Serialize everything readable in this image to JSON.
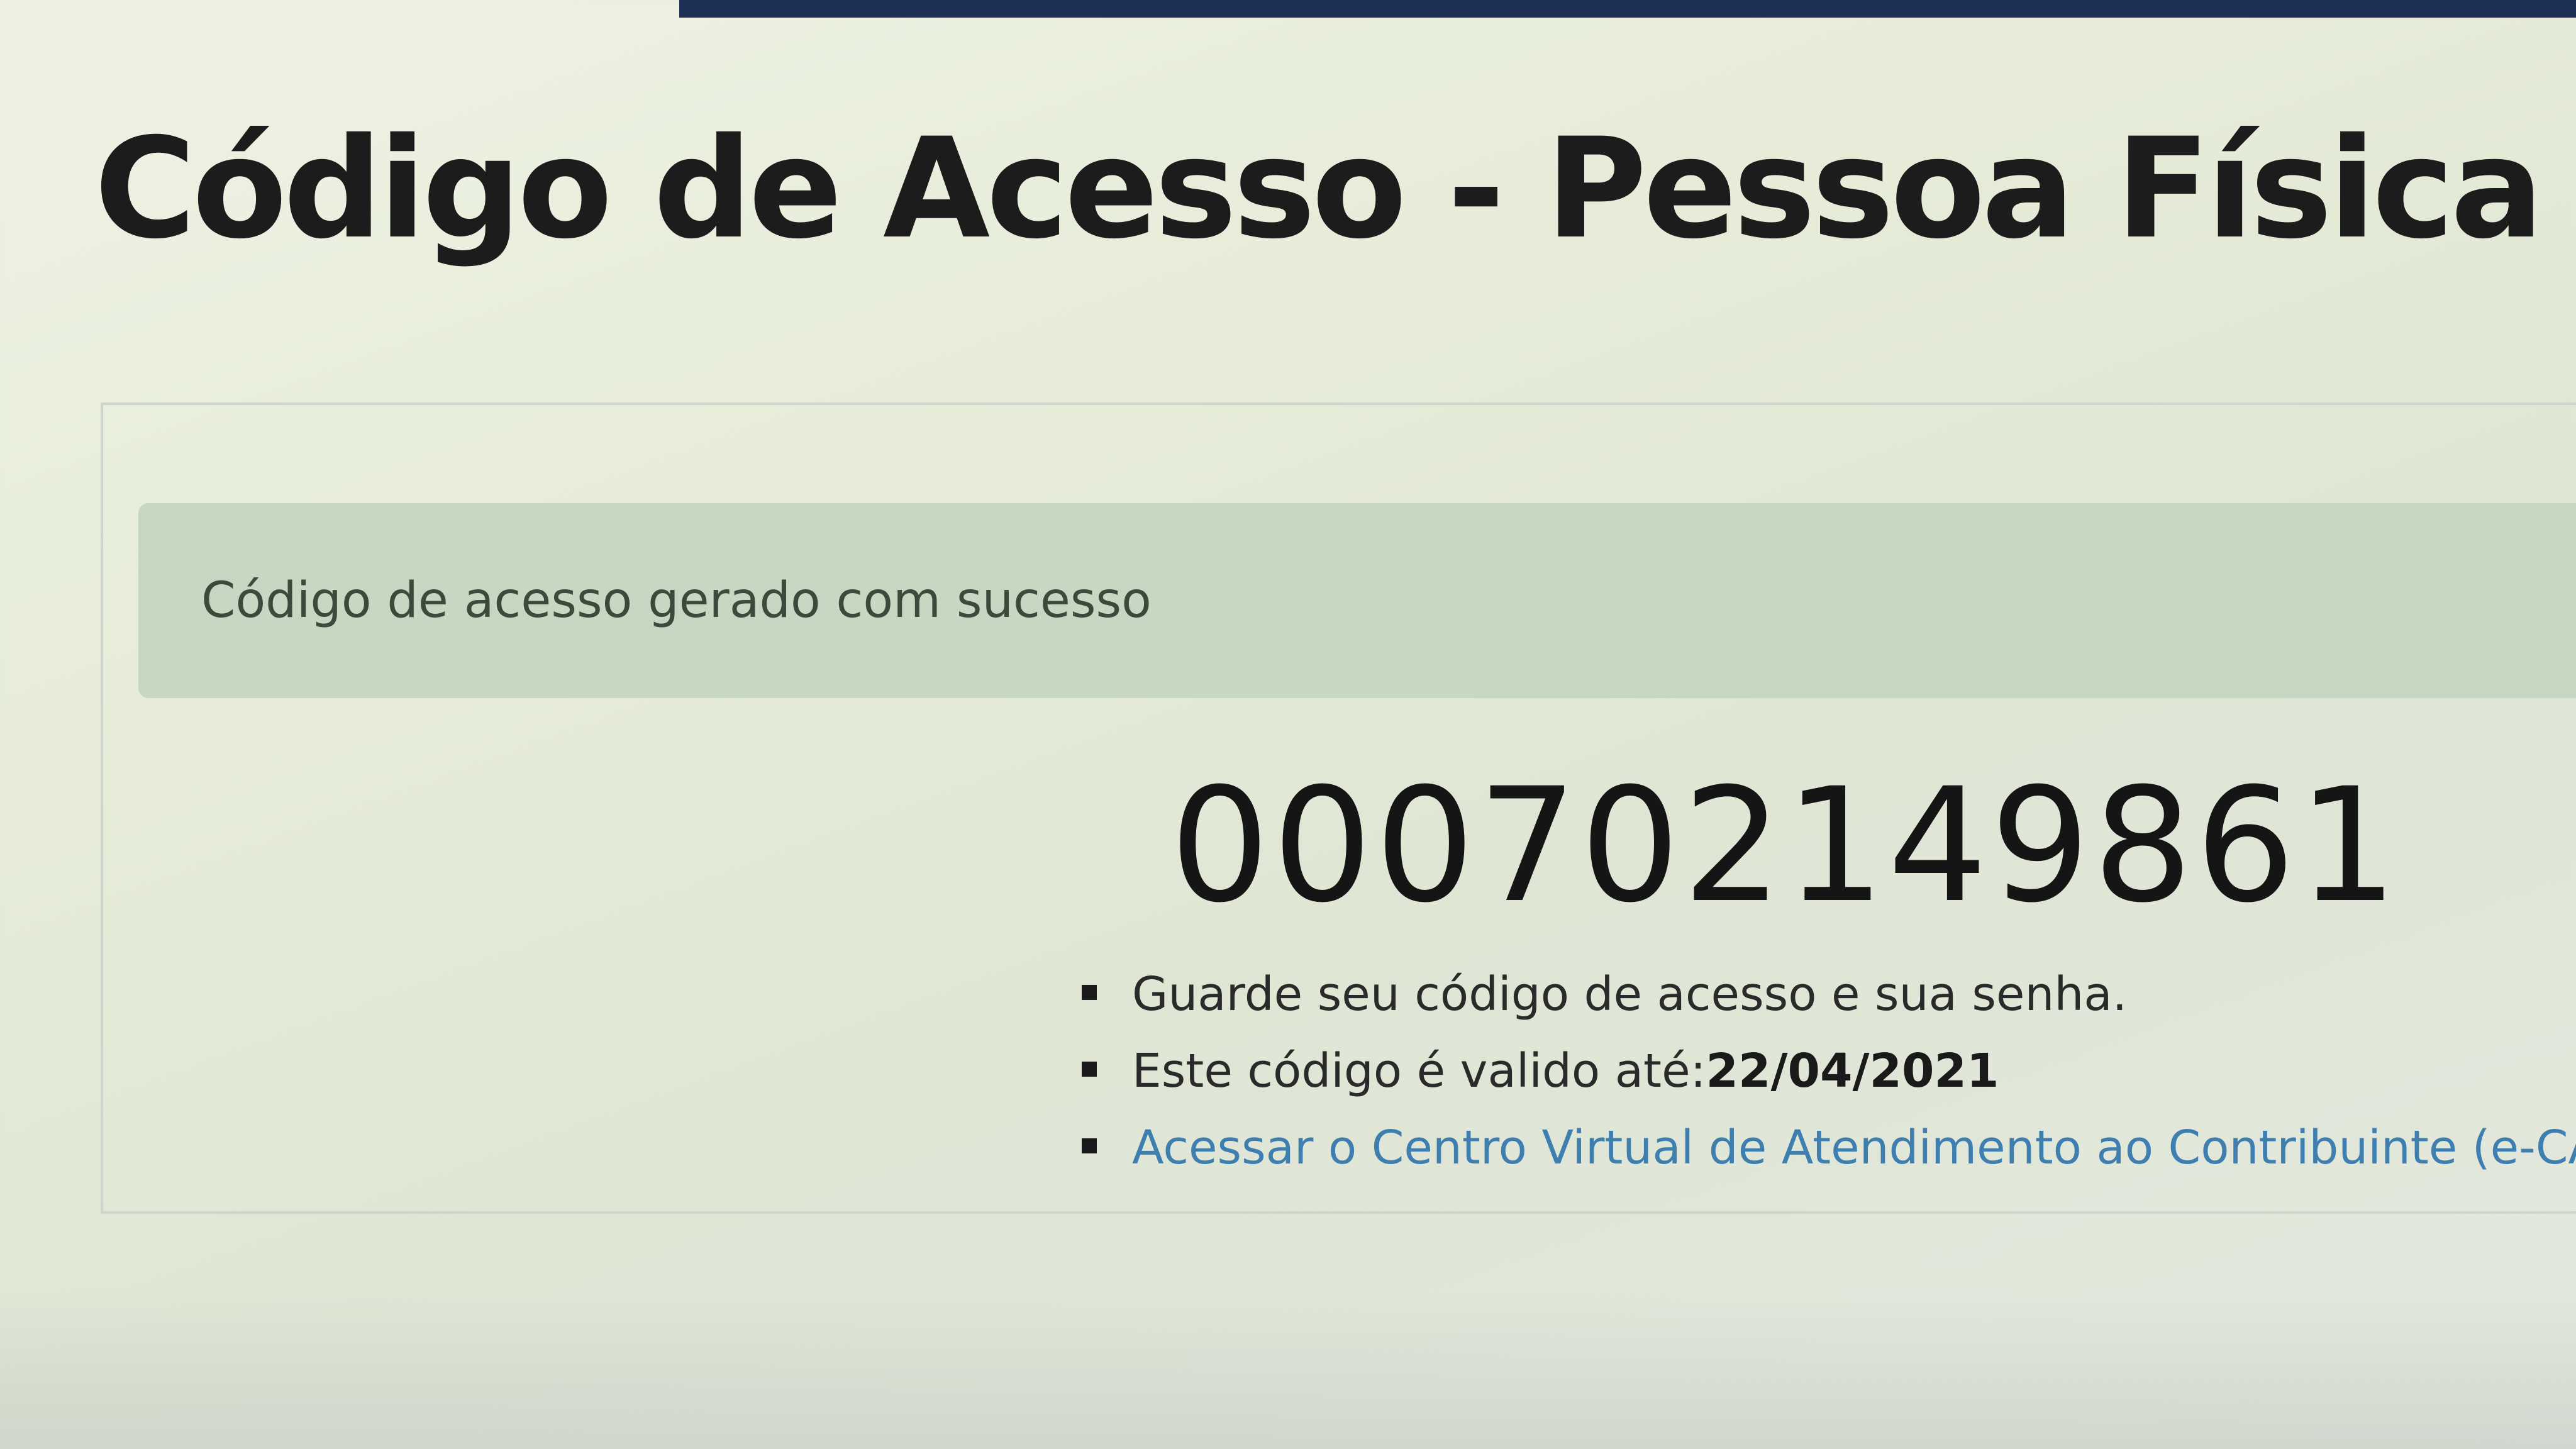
{
  "page": {
    "title": "Código de Acesso - Pessoa Física"
  },
  "alert": {
    "message": "Código de acesso gerado com sucesso"
  },
  "access_code": {
    "value": "000702149861"
  },
  "info": {
    "keep_notice": "Guarde seu código de acesso e sua senha.",
    "valid_label": "Este código é valido até:",
    "valid_date": "22/04/2021",
    "ecac_link": "Acessar o Centro Virtual de Atendimento ao Contribuinte (e-CAC)"
  },
  "colors": {
    "alert_background": "#c7d7c2",
    "link": "#3f7fb0",
    "top_strip": "#1e2f55"
  }
}
